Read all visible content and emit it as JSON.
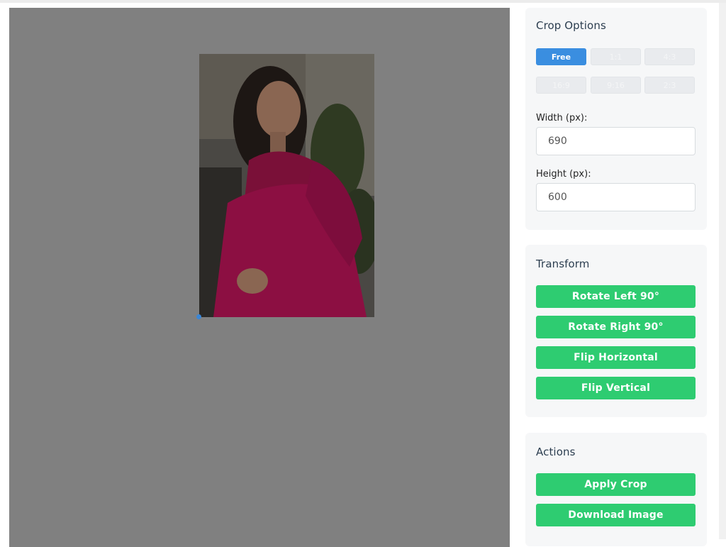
{
  "crop_options": {
    "title": "Crop Options",
    "ratios": [
      {
        "label": "Free",
        "active": true
      },
      {
        "label": "1:1",
        "active": false
      },
      {
        "label": "4:3",
        "active": false
      },
      {
        "label": "16:9",
        "active": false
      },
      {
        "label": "9:16",
        "active": false
      },
      {
        "label": "2:3",
        "active": false
      }
    ],
    "width_label": "Width (px):",
    "width_value": "690",
    "height_label": "Height (px):",
    "height_value": "600"
  },
  "transform": {
    "title": "Transform",
    "rotate_left": "Rotate Left 90°",
    "rotate_right": "Rotate Right 90°",
    "flip_horizontal": "Flip Horizontal",
    "flip_vertical": "Flip Vertical"
  },
  "actions": {
    "title": "Actions",
    "apply_crop": "Apply Crop",
    "download_image": "Download Image"
  },
  "colors": {
    "accent_blue": "#3a8ee0",
    "action_green": "#2ecc71",
    "canvas_gray": "#808080"
  }
}
